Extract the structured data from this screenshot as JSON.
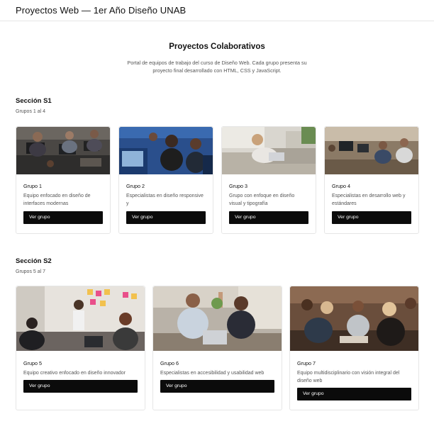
{
  "header": {
    "title": "Proyectos Web — 1er Año Diseño UNAB"
  },
  "intro": {
    "title": "Proyectos Colaborativos",
    "text": "Portal de equipos de trabajo del curso de Diseño Web. Cada grupo presenta su proyecto final desarrollado con HTML, CSS y JavaScript."
  },
  "sections": [
    {
      "title": "Sección S1",
      "subtitle": "Grupos 1 al 4",
      "groups": [
        {
          "name": "Grupo 1",
          "desc": "Equipo enfocado en diseño de interfaces modernas",
          "button": "Ver grupo"
        },
        {
          "name": "Grupo 2",
          "desc": "Especialistas en diseño responsive y",
          "button": "Ver grupo"
        },
        {
          "name": "Grupo 3",
          "desc": "Grupo con enfoque en diseño visual y tipografía",
          "button": "Ver grupo"
        },
        {
          "name": "Grupo 4",
          "desc": "Especialistas en desarrollo web y estándares",
          "button": "Ver grupo"
        }
      ]
    },
    {
      "title": "Sección S2",
      "subtitle": "Grupos 5 al 7",
      "groups": [
        {
          "name": "Grupo 5",
          "desc": "Equipo creativo enfocado en diseño innovador",
          "button": "Ver grupo"
        },
        {
          "name": "Grupo 6",
          "desc": "Especialistas en accesibilidad y usabilidad web",
          "button": "Ver grupo"
        },
        {
          "name": "Grupo 7",
          "desc": "Equipo multidisciplinario con visión integral del diseño web",
          "button": "Ver grupo"
        }
      ]
    }
  ]
}
